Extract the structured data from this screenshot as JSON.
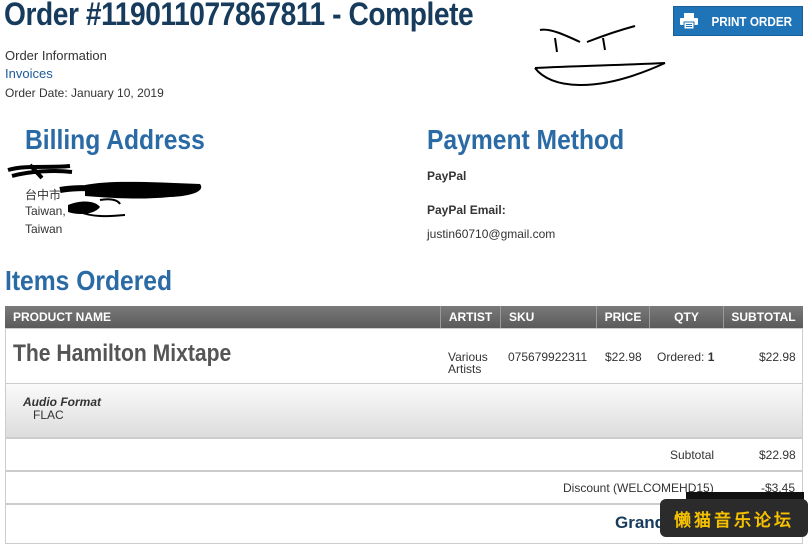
{
  "header": {
    "title": "Order #119011077867811 - Complete",
    "print_label": "PRINT ORDER",
    "order_info_label": "Order Information",
    "invoices_label": "Invoices",
    "order_date": "Order Date: January 10, 2019"
  },
  "billing": {
    "heading": "Billing Address",
    "line1": "台中市",
    "line2": "Taiwan,",
    "line3": "Taiwan"
  },
  "payment": {
    "heading": "Payment Method",
    "method": "PayPal",
    "email_label": "PayPal Email:",
    "email": "justin60710@gmail.com"
  },
  "items": {
    "heading": "Items Ordered",
    "columns": {
      "product": "PRODUCT NAME",
      "artist": "ARTIST",
      "sku": "SKU",
      "price": "PRICE",
      "qty": "QTY",
      "subtotal": "SUBTOTAL"
    },
    "rows": [
      {
        "product": "The Hamilton Mixtape",
        "artist_line1": "Various",
        "artist_line2": "Artists",
        "sku": "075679922311",
        "price": "$22.98",
        "qty_label": "Ordered:",
        "qty": "1",
        "subtotal": "$22.98",
        "option_label": "Audio Format",
        "option_value": "FLAC"
      }
    ]
  },
  "totals": {
    "subtotal_label": "Subtotal",
    "subtotal_value": "$22.98",
    "discount_label": "Discount (WELCOMEHD15)",
    "discount_value": "-$3.45",
    "grand_label": "Grand"
  },
  "watermark": "懒猫音乐论坛",
  "colors": {
    "title": "#163b5c",
    "section_heading": "#2a6aa5",
    "button": "#1f73b7",
    "table_header": "#6a6a6a"
  }
}
